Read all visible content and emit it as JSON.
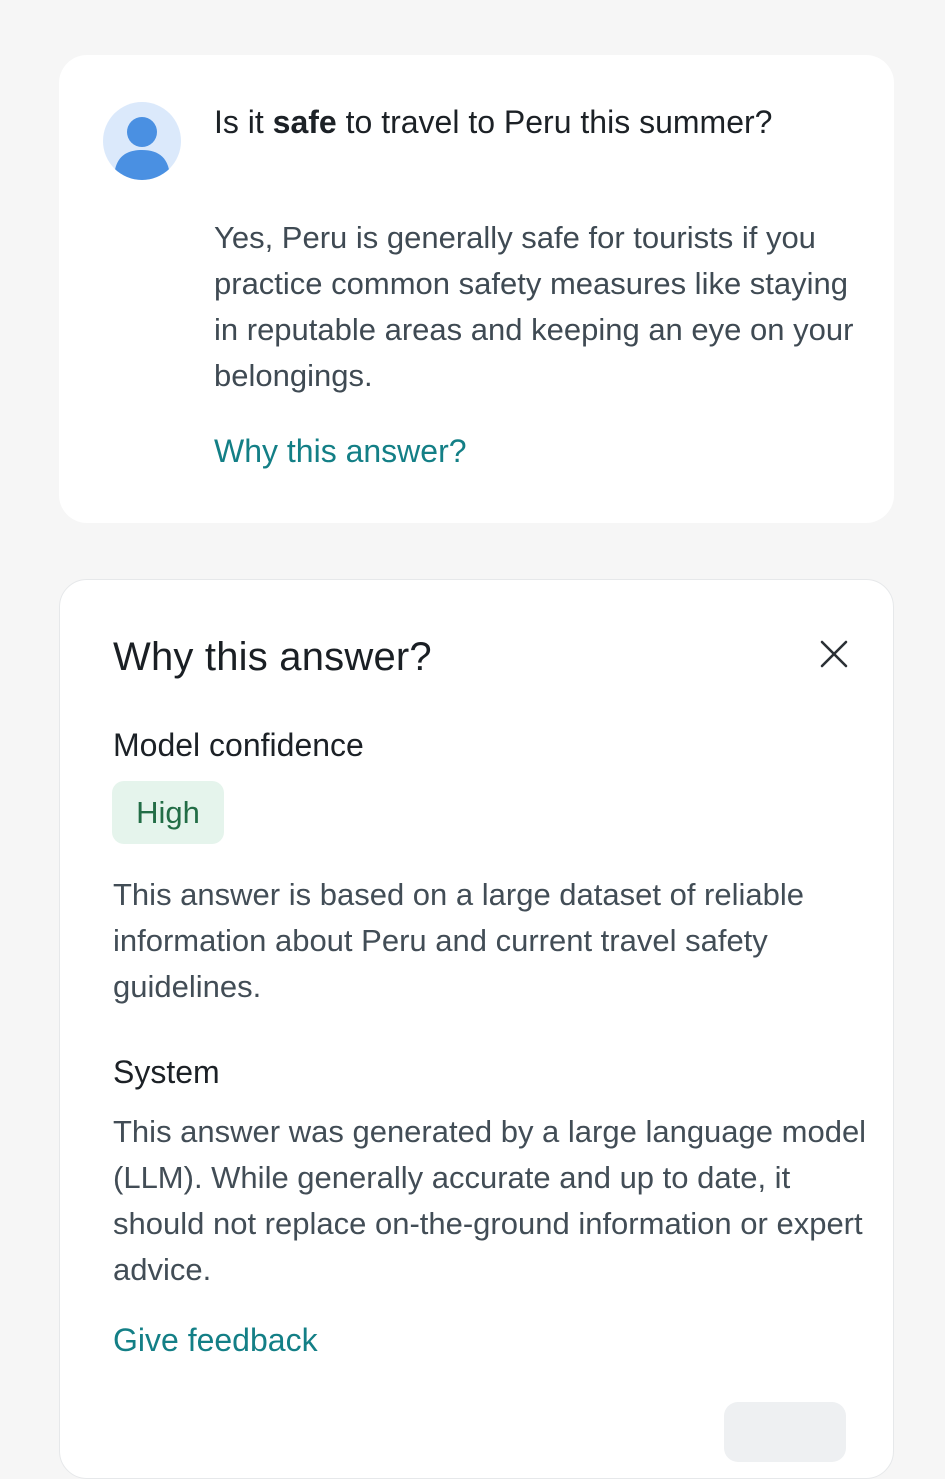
{
  "qa_card": {
    "question": {
      "before": "Is it ",
      "emphasis": "safe",
      "after": " to travel to Peru this summer?"
    },
    "answer": "Yes, Peru is generally safe for tourists if you practice common safety measures like staying in reputable areas and keeping an eye on your belongings.",
    "why_link": "Why this answer?",
    "avatar_icon": "user-avatar-icon"
  },
  "why_panel": {
    "title": "Why this answer?",
    "close_icon": "close-icon",
    "confidence": {
      "heading": "Model confidence",
      "badge": "High",
      "description": "This answer is based on a large dataset of reliable information about Peru and current travel safety guidelines."
    },
    "system": {
      "heading": "System",
      "description": "This answer was generated by a large language model (LLM). While generally accurate and up to date, it should not replace on-the-ground information or expert advice."
    },
    "feedback_link": "Give feedback"
  },
  "colors": {
    "background": "#f6f6f6",
    "card": "#ffffff",
    "link": "#137f86",
    "badge_bg": "#e5f4ec",
    "badge_text": "#226d46",
    "avatar_bg": "#dbe9fb",
    "avatar_fg": "#4a90e2"
  }
}
